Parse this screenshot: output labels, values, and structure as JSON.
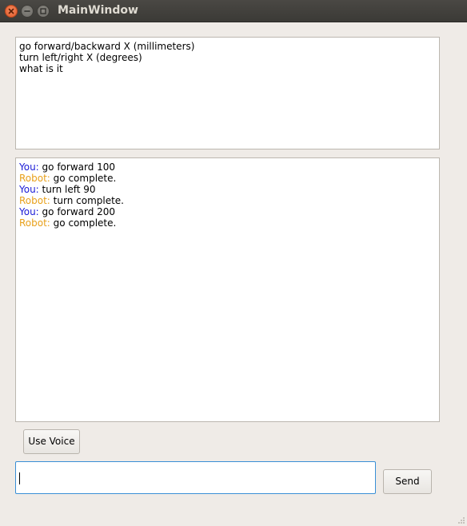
{
  "window": {
    "title": "MainWindow"
  },
  "help_lines": [
    "go forward/backward X (millimeters)",
    "turn left/right X (degrees)",
    "what is it"
  ],
  "chat": [
    {
      "speaker": "You:",
      "text": " go forward 100"
    },
    {
      "speaker": "Robot:",
      "text": " go complete."
    },
    {
      "speaker": "You:",
      "text": " turn left 90"
    },
    {
      "speaker": "Robot:",
      "text": " turn complete."
    },
    {
      "speaker": "You:",
      "text": " go forward 200"
    },
    {
      "speaker": "Robot:",
      "text": " go complete."
    }
  ],
  "buttons": {
    "voice": "Use Voice",
    "send": "Send"
  },
  "input": {
    "value": ""
  },
  "colors": {
    "you": "#1a1ad6",
    "robot": "#e8a01a",
    "focus": "#3a8fd6"
  }
}
